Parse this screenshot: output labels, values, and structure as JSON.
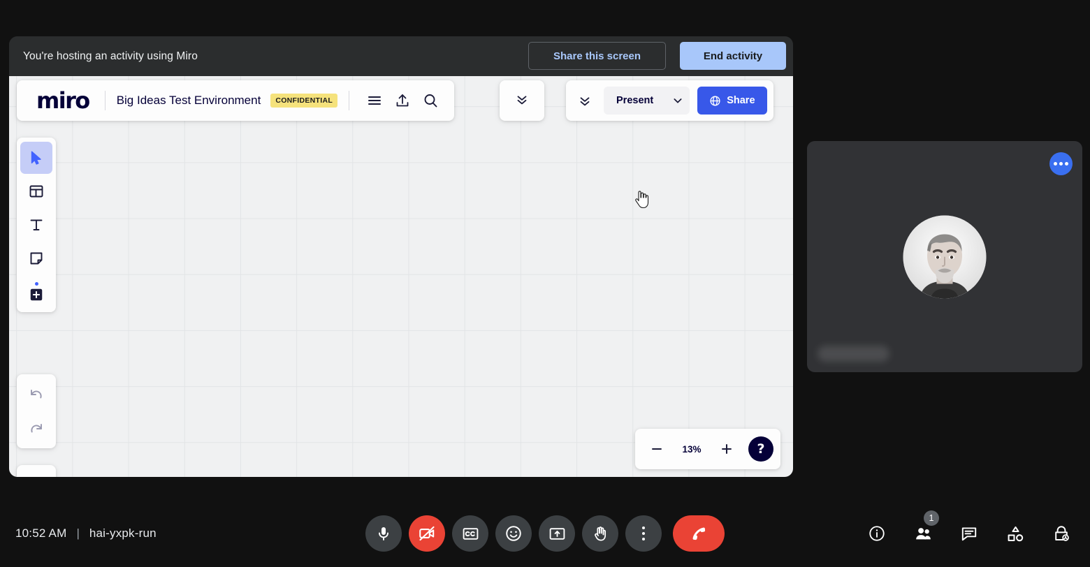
{
  "host_banner": {
    "message": "You're hosting an activity using Miro",
    "share_screen_label": "Share this screen",
    "end_activity_label": "End activity",
    "background": "#2b2d2e",
    "end_activity_color": "#a8c7fa",
    "share_screen_text_color": "#a8c7fa"
  },
  "miro": {
    "logo": "miro",
    "board_title": "Big Ideas Test Environment",
    "confidential_badge": "CONFIDENTIAL",
    "badge_color": "#f5e27c",
    "header_icons": [
      {
        "name": "hamburger-menu-icon",
        "label": "Menu"
      },
      {
        "name": "upload-icon",
        "label": "Upload"
      },
      {
        "name": "search-icon",
        "label": "Search"
      }
    ],
    "collapse_chevron": "chevron-double-down-icon",
    "present_label": "Present",
    "present_dropdown_icon": "chevron-down-icon",
    "share_label": "Share",
    "share_icon": "globe-icon",
    "share_color": "#3858e9",
    "tools": [
      {
        "name": "select-tool",
        "icon": "cursor-arrow-icon",
        "active": true
      },
      {
        "name": "templates-tool",
        "icon": "layout-template-icon",
        "active": false
      },
      {
        "name": "text-tool",
        "icon": "text-t-icon",
        "active": false
      },
      {
        "name": "sticky-note-tool",
        "icon": "sticky-note-icon",
        "active": false
      },
      {
        "name": "more-apps-tool",
        "icon": "plus-square-icon",
        "active": false
      }
    ],
    "history_tools": [
      {
        "name": "undo-tool",
        "icon": "undo-arrow-icon"
      },
      {
        "name": "redo-tool",
        "icon": "redo-arrow-icon"
      }
    ],
    "panel_tool": {
      "name": "toggle-sidebar-tool",
      "icon": "sidebar-panel-icon"
    },
    "zoom": {
      "minus_icon": "minus-icon",
      "level": "13%",
      "plus_icon": "plus-icon",
      "help_label": "?"
    },
    "canvas_bg": "#f0f1f2",
    "grid_line_color": "#e2e4e6"
  },
  "video_tile": {
    "more_options_icon": "more-horizontal-icon",
    "more_options_color": "#3a6ff0",
    "name_label": "",
    "avatar_name": "participant-avatar",
    "background": "#313235"
  },
  "bottom_bar": {
    "time": "10:52 AM",
    "separator": "|",
    "meeting_code": "hai-yxpk-run",
    "controls": [
      {
        "name": "microphone-button",
        "icon": "microphone-icon",
        "state": "on",
        "danger": false
      },
      {
        "name": "camera-button",
        "icon": "camera-off-icon",
        "state": "off",
        "danger": true
      },
      {
        "name": "captions-button",
        "icon": "closed-captions-icon",
        "state": "off",
        "danger": false
      },
      {
        "name": "reactions-button",
        "icon": "emoji-smiley-icon",
        "state": "off",
        "danger": false
      },
      {
        "name": "present-now-button",
        "icon": "screen-share-icon",
        "state": "off",
        "danger": false
      },
      {
        "name": "raise-hand-button",
        "icon": "raised-hand-icon",
        "state": "off",
        "danger": false
      },
      {
        "name": "more-options-button",
        "icon": "more-vertical-icon",
        "state": "off",
        "danger": false
      }
    ],
    "hangup": {
      "name": "leave-call-button",
      "icon": "phone-hangup-icon",
      "color": "#ea4335"
    },
    "right_controls": [
      {
        "name": "meeting-details-button",
        "icon": "info-circle-icon",
        "badge": ""
      },
      {
        "name": "people-button",
        "icon": "people-icon",
        "badge": "1"
      },
      {
        "name": "chat-button",
        "icon": "chat-bubble-icon",
        "badge": ""
      },
      {
        "name": "activities-button",
        "icon": "shapes-activities-icon",
        "badge": ""
      },
      {
        "name": "host-controls-button",
        "icon": "lock-host-icon",
        "badge": ""
      }
    ]
  }
}
